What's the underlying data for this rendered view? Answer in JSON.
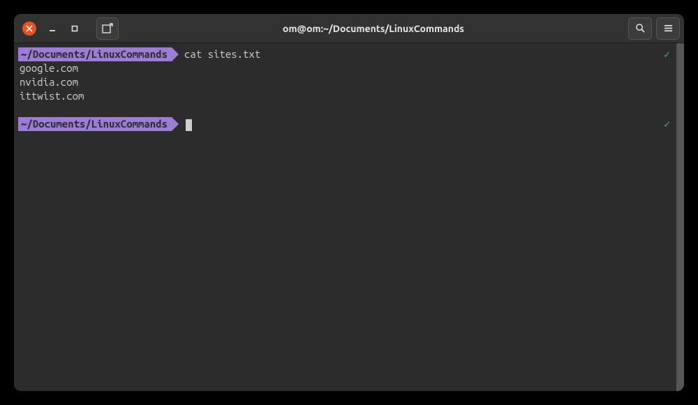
{
  "window": {
    "title": "om@om:~/Documents/LinuxCommands"
  },
  "terminal": {
    "prompts": [
      {
        "path": "~/Documents/LinuxCommands",
        "command": "cat sites.txt",
        "status": "✓"
      },
      {
        "path": "~/Documents/LinuxCommands",
        "command": "",
        "status": "✓"
      }
    ],
    "output": [
      "google.com",
      "nvidia.com",
      "ittwist.com"
    ]
  }
}
